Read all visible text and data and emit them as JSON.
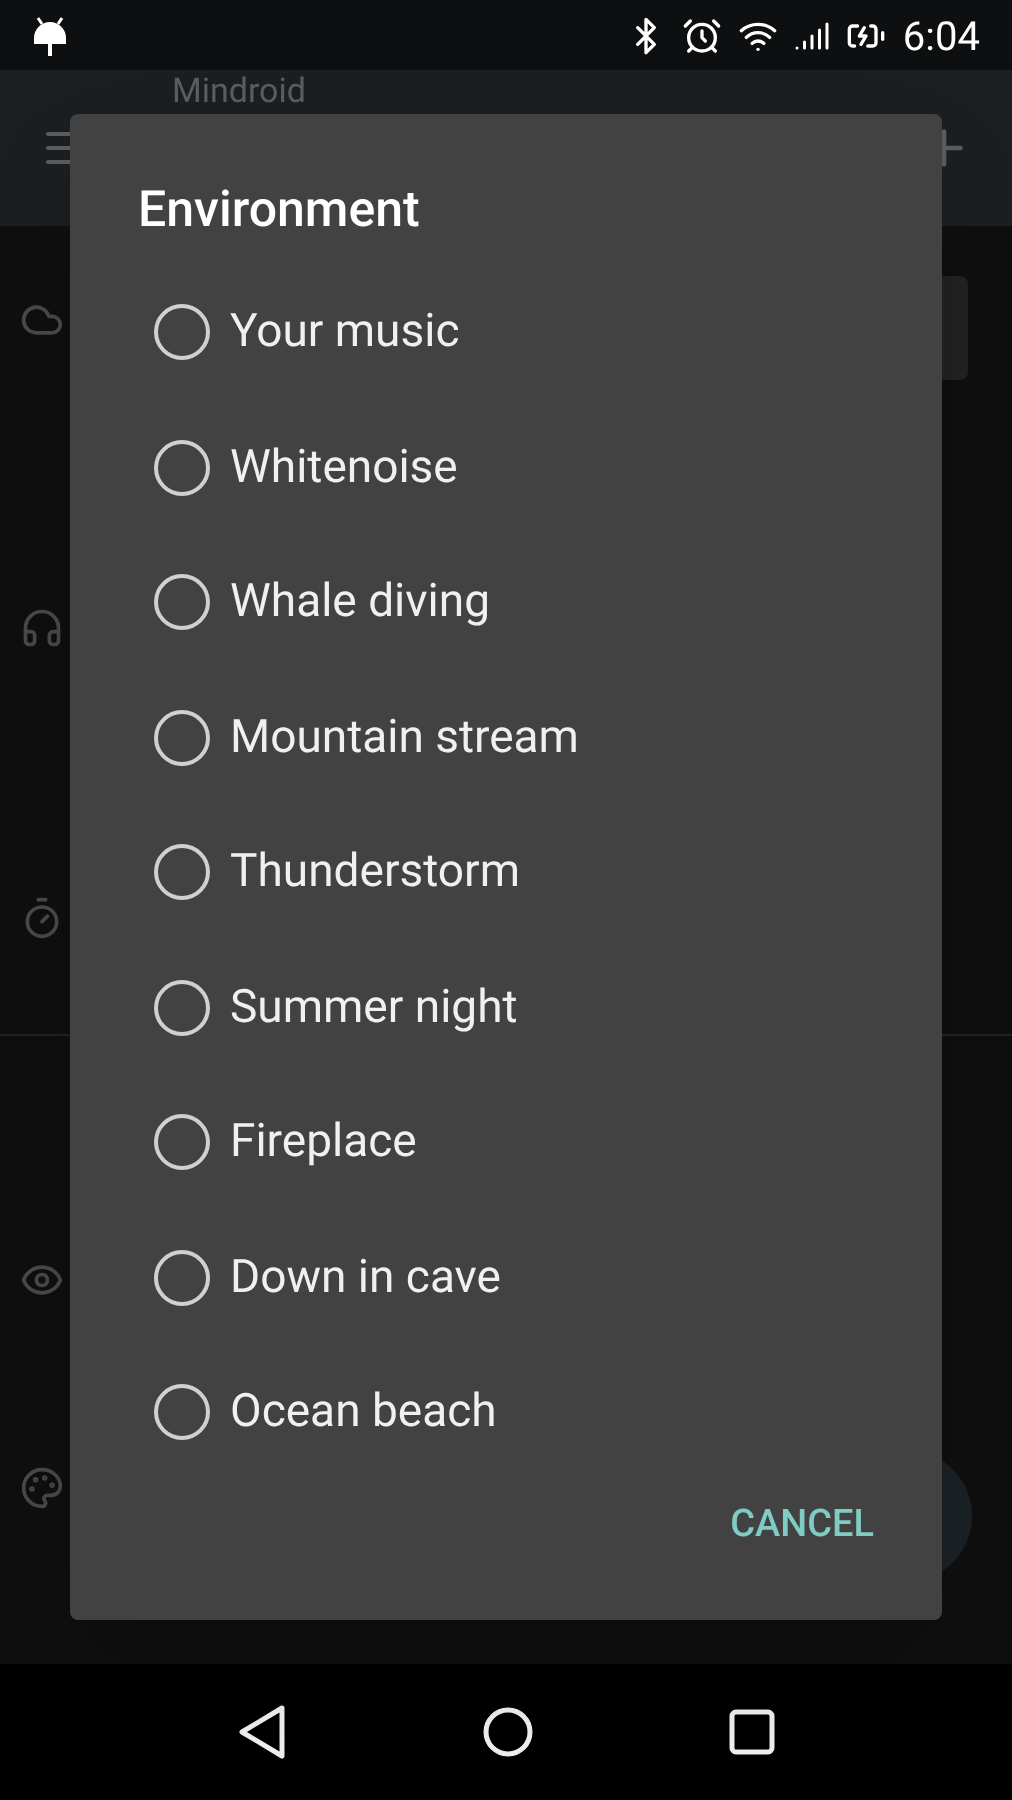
{
  "status_bar": {
    "time": "6:04"
  },
  "app_bar": {
    "title": "Mindroid"
  },
  "dialog": {
    "title": "Environment",
    "options": [
      {
        "label": "Your music",
        "selected": false
      },
      {
        "label": "Whitenoise",
        "selected": false
      },
      {
        "label": "Whale diving",
        "selected": false
      },
      {
        "label": "Mountain stream",
        "selected": false
      },
      {
        "label": "Thunderstorm",
        "selected": false
      },
      {
        "label": "Summer night",
        "selected": false
      },
      {
        "label": "Fireplace",
        "selected": false
      },
      {
        "label": "Down in cave",
        "selected": false
      },
      {
        "label": "Ocean beach",
        "selected": false
      }
    ],
    "buttons": [
      "CANCEL"
    ]
  }
}
